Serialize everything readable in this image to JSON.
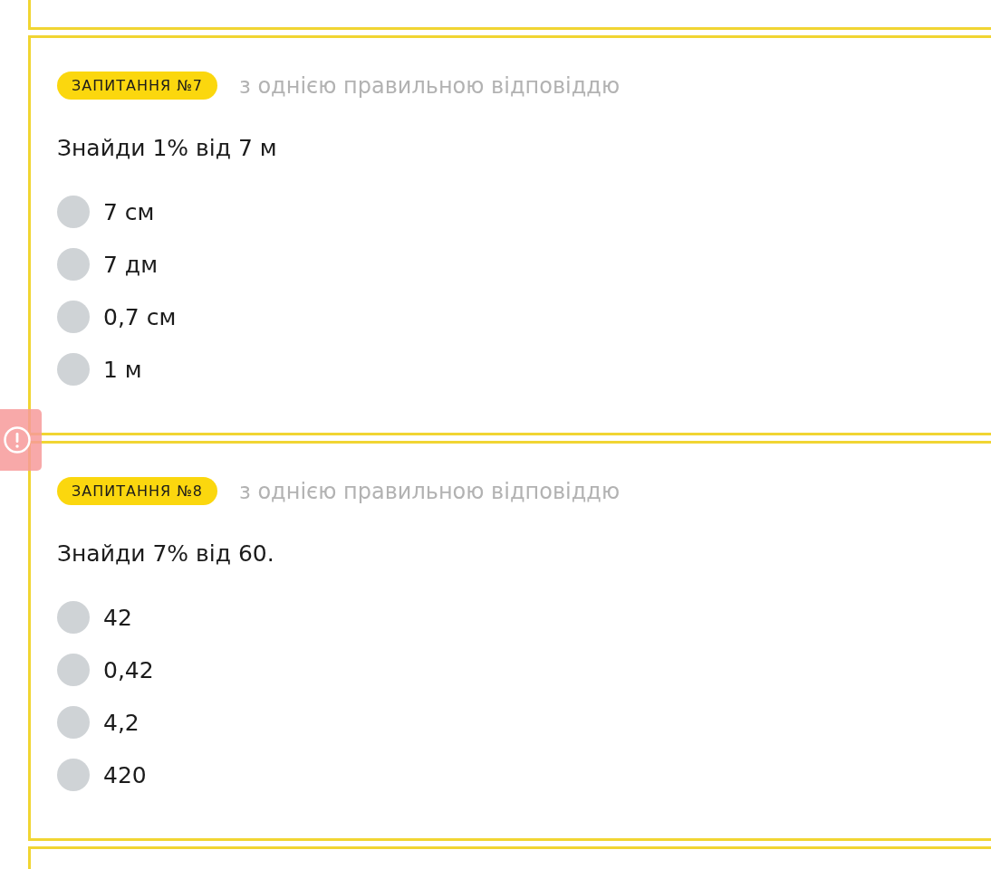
{
  "questions": [
    {
      "badge": "ЗАПИТАННЯ №7",
      "answer_type": "з однією правильною відповіддю",
      "text": "Знайди 1% від 7 м",
      "options": [
        {
          "label": "7 см",
          "selected": false
        },
        {
          "label": "7 дм",
          "selected": false
        },
        {
          "label": "0,7 см",
          "selected": false
        },
        {
          "label": "1 м",
          "selected": false
        }
      ]
    },
    {
      "badge": "ЗАПИТАННЯ №8",
      "answer_type": "з однією правильною відповіддю",
      "text": "Знайди 7% від 60.",
      "options": [
        {
          "label": "42",
          "selected": false
        },
        {
          "label": "0,42",
          "selected": false
        },
        {
          "label": "4,2",
          "selected": false
        },
        {
          "label": "420",
          "selected": false
        }
      ]
    }
  ]
}
